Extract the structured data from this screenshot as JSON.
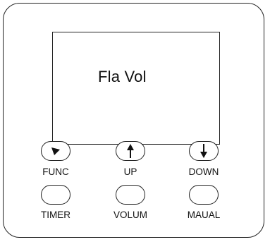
{
  "display": {
    "text": "Fla Vol"
  },
  "buttons": {
    "func": {
      "label": "FUNC",
      "icon": "play-down-icon"
    },
    "up": {
      "label": "UP",
      "icon": "arrow-up-icon"
    },
    "down": {
      "label": "DOWN",
      "icon": "arrow-down-icon"
    },
    "timer": {
      "label": "TIMER"
    },
    "volum": {
      "label": "VOLUM"
    },
    "maual": {
      "label": "MAUAL"
    }
  },
  "colors": {
    "stroke": "#222222",
    "background": "#ffffff"
  }
}
